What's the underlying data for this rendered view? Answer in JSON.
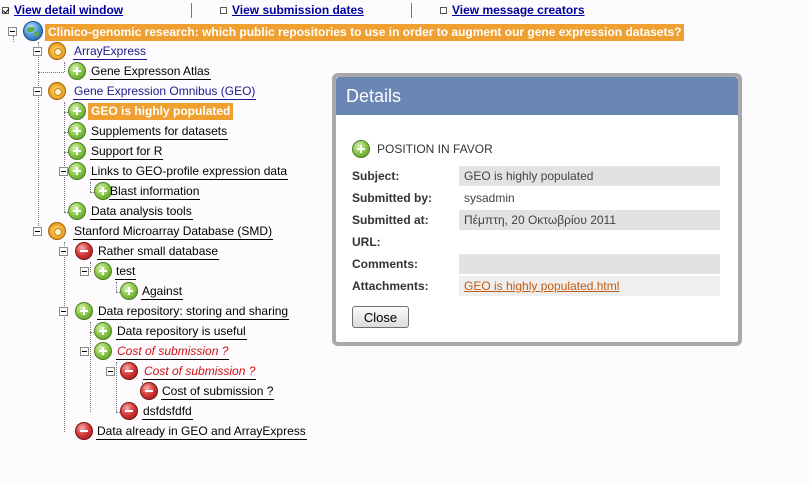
{
  "toolbar": {
    "items": [
      {
        "label": "View detail window",
        "checked": true
      },
      {
        "label": "View submission dates",
        "checked": false
      },
      {
        "label": "View message creators",
        "checked": false
      }
    ]
  },
  "tree": {
    "root": "Clinico-genomic research: which public repositories to use in order to augment our gene expression datasets?",
    "nodes": [
      {
        "label": "ArrayExpress",
        "type": "issue"
      },
      {
        "label": "Gene Expresson Atlas",
        "type": "pro"
      },
      {
        "label": "Gene Expression Omnibus (GEO)",
        "type": "issue"
      },
      {
        "label": "GEO is highly populated",
        "type": "pro",
        "selected": true
      },
      {
        "label": "Supplements for datasets",
        "type": "pro"
      },
      {
        "label": "Support for R",
        "type": "pro"
      },
      {
        "label": "Links to GEO-profile expression data",
        "type": "pro"
      },
      {
        "label": "Blast information",
        "type": "pro"
      },
      {
        "label": "Data analysis tools",
        "type": "pro"
      },
      {
        "label": "Stanford Microarray Database (SMD)",
        "type": "issue"
      },
      {
        "label": "Rather small database",
        "type": "con"
      },
      {
        "label": "test",
        "type": "pro"
      },
      {
        "label": "Against",
        "type": "pro"
      },
      {
        "label": "Data repository: storing and sharing",
        "type": "pro"
      },
      {
        "label": "Data repository is useful",
        "type": "pro"
      },
      {
        "label": "Cost of submission ?",
        "type": "pro"
      },
      {
        "label": "Cost of submission ?",
        "type": "con"
      },
      {
        "label": "Cost of submission ?",
        "type": "con"
      },
      {
        "label": "dsfdsfdfd",
        "type": "con"
      },
      {
        "label": "Data already in GEO and ArrayExpress",
        "type": "con"
      }
    ]
  },
  "details": {
    "title": "Details",
    "position": "POSITION IN FAVOR",
    "fields": [
      {
        "label": "Subject:",
        "value": "GEO is highly populated"
      },
      {
        "label": "Submitted by:",
        "value": "sysadmin"
      },
      {
        "label": "Submitted at:",
        "value": "Πέμπτη, 20 Οκτωβρίου 2011"
      },
      {
        "label": "URL:",
        "value": ""
      },
      {
        "label": "Comments:",
        "value": ""
      },
      {
        "label": "Attachments:",
        "value": "GEO is highly populated.html"
      }
    ],
    "close_label": "Close"
  },
  "colors": {
    "highlight": "#f0a030",
    "header": "#6a86b4",
    "link": "#00009c"
  }
}
